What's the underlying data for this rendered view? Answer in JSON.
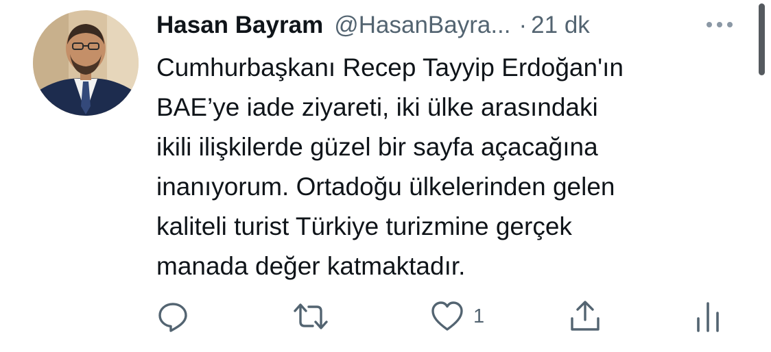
{
  "tweet": {
    "author": {
      "display_name": "Hasan Bayram",
      "handle": "@HasanBayra..."
    },
    "separator": "·",
    "time": "21 dk",
    "text_lines": [
      "Cumhurbaşkanı Recep Tayyip Erdoğan'ın",
      "BAE’ye iade ziyareti, iki ülke arasındaki",
      "ikili ilişkilerde güzel bir sayfa açacağına",
      "inanıyorum. Ortadoğu ülkelerinden gelen",
      "kaliteli turist Türkiye turizmine gerçek",
      "manada değer katmaktadır."
    ],
    "actions": {
      "reply_icon": "speech-bubble-icon",
      "retweet_icon": "retweet-arrows-icon",
      "like_icon": "heart-icon",
      "like_count": "1",
      "share_icon": "share-upload-icon",
      "analytics_icon": "bar-chart-icon"
    },
    "more_icon": "more-dots-icon"
  },
  "colors": {
    "text_primary": "#0f1419",
    "text_secondary": "#536471",
    "background": "#ffffff"
  }
}
